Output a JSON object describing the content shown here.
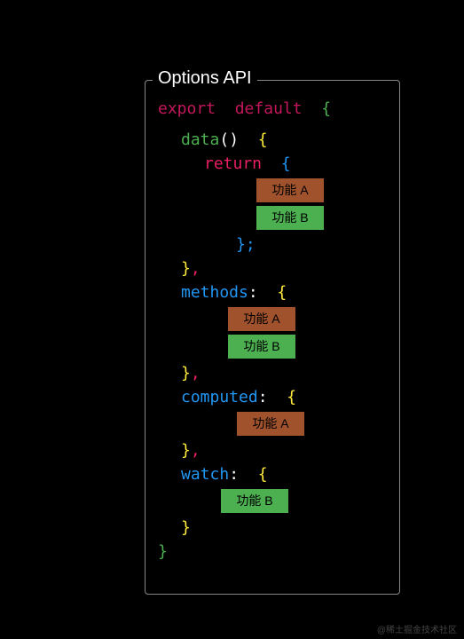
{
  "panel": {
    "title": "Options API"
  },
  "code": {
    "export": "export",
    "default": "default",
    "data": "data",
    "return": "return",
    "methods": "methods",
    "computed": "computed",
    "watch": "watch",
    "open_brace": "{",
    "close_brace": "}",
    "open_paren": "(",
    "close_paren": ")",
    "semicolon": ";",
    "comma": ",",
    "colon": ":"
  },
  "badges": {
    "feature_a": "功能 A",
    "feature_b": "功能 B"
  },
  "watermark": "@稀土掘金技术社区"
}
